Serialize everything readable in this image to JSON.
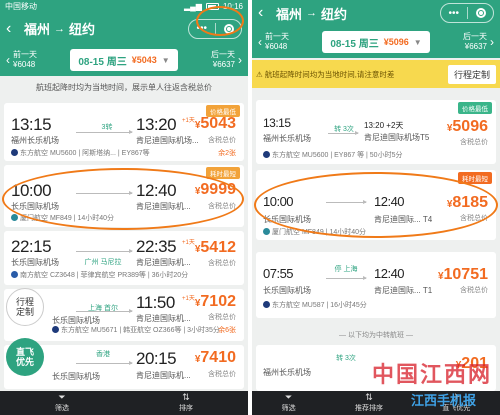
{
  "left": {
    "status": {
      "carrier": "中国移动",
      "time": "10:16"
    },
    "header": {
      "back": "‹",
      "from": "福州",
      "arrow": "→",
      "to": "纽约",
      "more": "•••"
    },
    "datebar": {
      "prev_label": "前一天",
      "prev_price": "¥6048",
      "date": "08-15 周三",
      "price": "¥5043",
      "next_label": "后一天",
      "next_price": "¥6637"
    },
    "notice": "航班起降时均为当地时间，展示单人往返含税总价",
    "flights": [
      {
        "badge": "价格最低",
        "dep": "13:15",
        "dep_ap": "福州长乐机场",
        "stop": "3转",
        "arr": "13:20",
        "plus": "+1天",
        "arr_ap": "肯尼迪国际机场...",
        "price": "5043",
        "tax": "含税总价",
        "airline": "东方航空 MU5600 | 阿斯塔纳... | EY867等",
        "duration": "37时5分",
        "extra": "余2张"
      },
      {
        "badge": "耗时最短",
        "dep": "10:00",
        "dep_ap": "长乐国际机场",
        "stop": "",
        "arr": "12:40",
        "plus": "",
        "arr_ap": "肯尼迪国际机...",
        "price": "9999",
        "tax": "含税总价",
        "airline": "厦门航空 MF849 | 14小时40分",
        "duration": "",
        "extra": ""
      },
      {
        "badge": "",
        "dep": "22:15",
        "dep_ap": "长乐国际机场",
        "stop": "广州  马尼拉",
        "arr": "22:35",
        "plus": "+1天",
        "arr_ap": "肯尼迪国际机...",
        "price": "5412",
        "tax": "含税总价",
        "airline": "南方航空 CZ3648 | 菲律宾航空 PR389等 | 36小时20分",
        "duration": "",
        "extra": ""
      },
      {
        "badge": "",
        "dep": "",
        "dep_ap": "长乐国际机场",
        "stop": "上海  首尔",
        "arr": "11:50",
        "plus": "+1天",
        "arr_ap": "肯尼迪国际机...",
        "price": "7102",
        "tax": "含税总价",
        "airline": "东方航空 MU5671 | 韩亚航空 OZ366等 | 3小时35分",
        "duration": "",
        "extra": "余6张"
      },
      {
        "badge": "",
        "dep": "",
        "dep_ap": "长乐国际机场",
        "stop": "香港",
        "arr": "20:15",
        "plus": "",
        "arr_ap": "肯尼迪国际机...",
        "price": "7410",
        "tax": "含税总价",
        "airline": "",
        "duration": "",
        "extra": ""
      }
    ],
    "fab_custom": "行程定制",
    "fab_direct": "直飞优先",
    "bottom": {
      "filter": "筛选",
      "sort": "排序"
    }
  },
  "right": {
    "header": {
      "back": "‹",
      "from": "福州",
      "arrow": "→",
      "to": "纽约",
      "more": "•••"
    },
    "datebar": {
      "prev_label": "前一天",
      "prev_price": "¥6048",
      "date": "08-15 周三",
      "price": "¥5096",
      "next_label": "后一天",
      "next_price": "¥6637"
    },
    "notice": "航班起降时间均为当地时间,请注意时差",
    "notice_button": "行程定制",
    "flights": [
      {
        "badge": "价格最低",
        "dep": "13:15",
        "dep_ap": "福州长乐机场",
        "stop": "转 3次",
        "arr": "13:20",
        "plus": "+2天",
        "arr_ap": "肯尼迪国际机场T5",
        "price": "5096",
        "tax": "含税总价",
        "airline": "东方航空 MU5600 | EY867 等 | 50小时5分"
      },
      {
        "badge": "耗时最短",
        "dep": "10:00",
        "dep_ap": "长乐国际机场",
        "stop": "",
        "arr": "12:40",
        "plus": "",
        "arr_ap": "肯尼迪国际... T4",
        "price": "8185",
        "tax": "含税总价",
        "airline": "厦门航空 MF849 | 14小时40分"
      },
      {
        "badge": "",
        "dep": "07:55",
        "dep_ap": "长乐国际机场",
        "stop": "停 上海",
        "arr": "12:40",
        "plus": "",
        "arr_ap": "肯尼迪国际... T1",
        "price": "10751",
        "tax": "含税总价",
        "airline": "东方航空 MU587 | 16小时45分"
      },
      {
        "badge": "",
        "dep": "",
        "dep_ap": "福州长乐机场",
        "stop": "转 3次",
        "arr": "",
        "plus": "",
        "arr_ap": "",
        "price": "201",
        "tax": "",
        "airline": ""
      }
    ],
    "divider": "以下均为中转航班",
    "bottom": {
      "filter": "筛选",
      "sort": "推荐排序",
      "direct": "直飞优先"
    },
    "watermark": "中国江西网",
    "watermark2": "江西手机报"
  },
  "colors": {
    "brand": "#2ea380",
    "price": "#f26b21",
    "highlight": "#f07a18"
  }
}
